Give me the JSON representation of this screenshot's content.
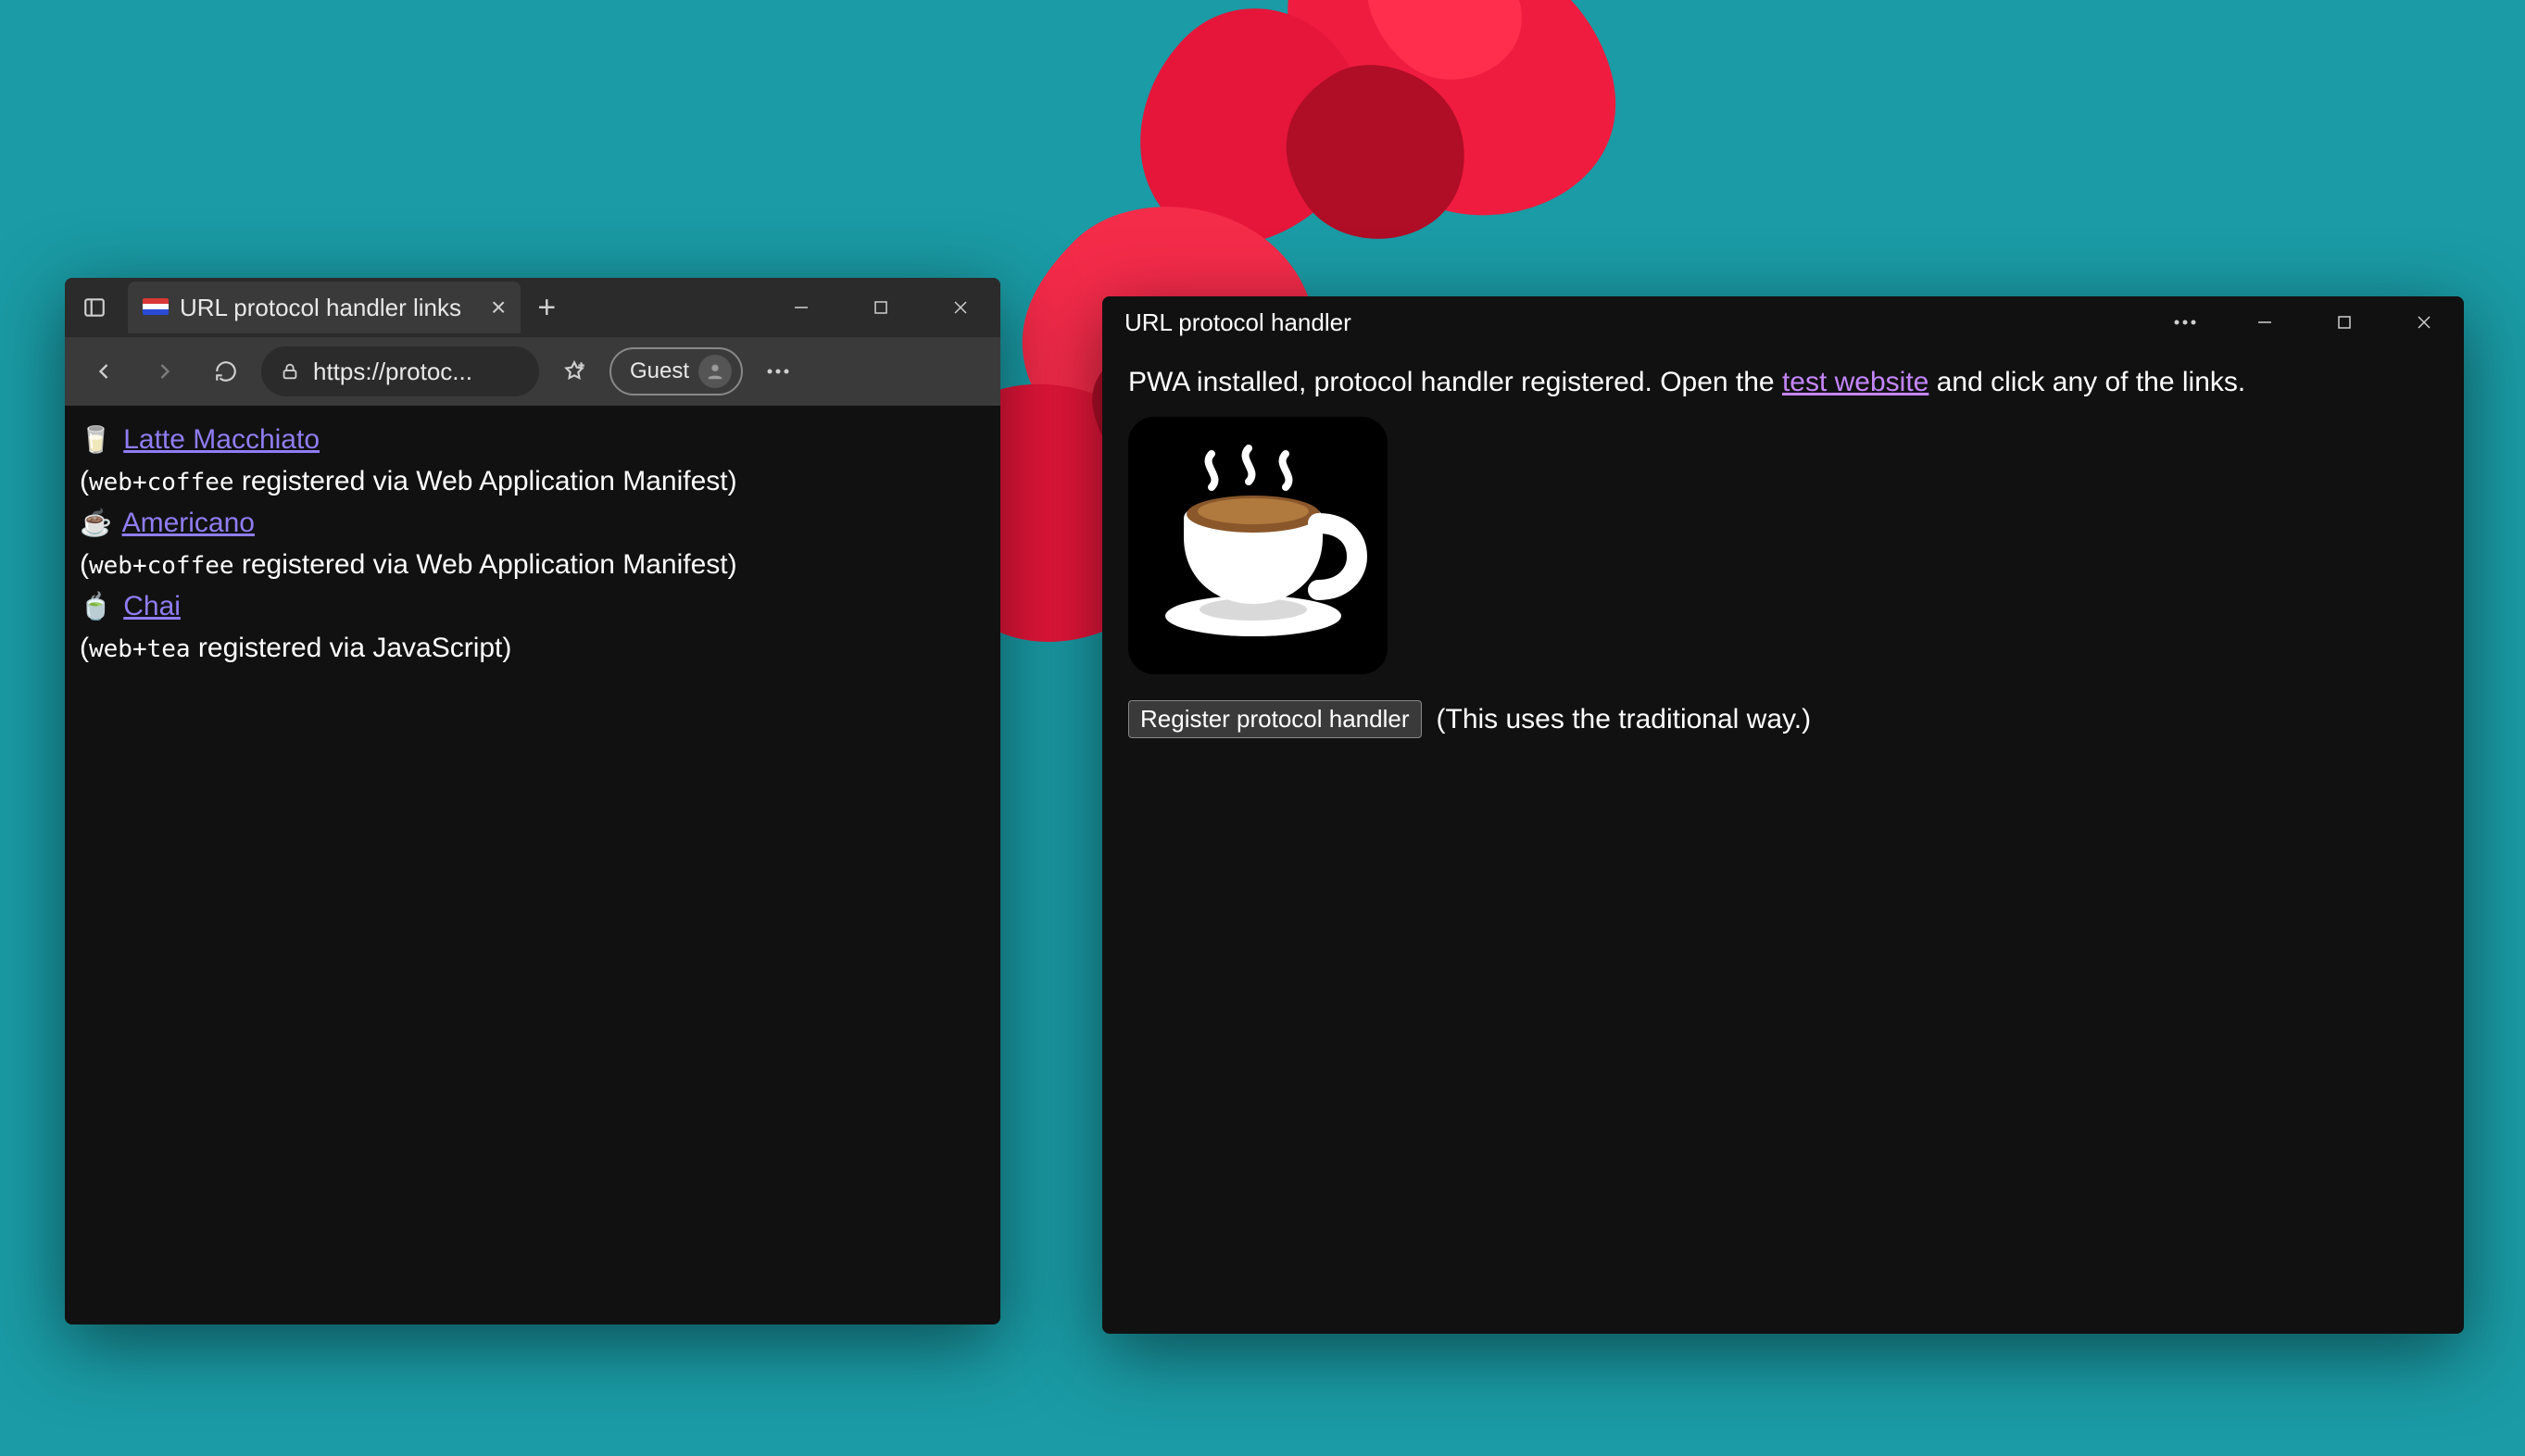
{
  "browser": {
    "tab_title": "URL protocol handler links",
    "address": "https://protoc...",
    "guest_label": "Guest",
    "links": [
      {
        "emoji": "🥛",
        "label": "Latte Macchiato",
        "scheme": "web+coffee",
        "via": " registered via Web Application Manifest)"
      },
      {
        "emoji": "☕",
        "label": "Americano",
        "scheme": "web+coffee",
        "via": " registered via Web Application Manifest)"
      },
      {
        "emoji": "🍵",
        "label": "Chai",
        "scheme": "web+tea",
        "via": " registered via JavaScript)"
      }
    ]
  },
  "pwa": {
    "title": "URL protocol handler",
    "status_prefix": "PWA installed, protocol handler registered. Open the ",
    "status_link": "test website",
    "status_suffix": " and click any of the links.",
    "button_label": "Register protocol handler",
    "button_note": "(This uses the traditional way.)"
  }
}
